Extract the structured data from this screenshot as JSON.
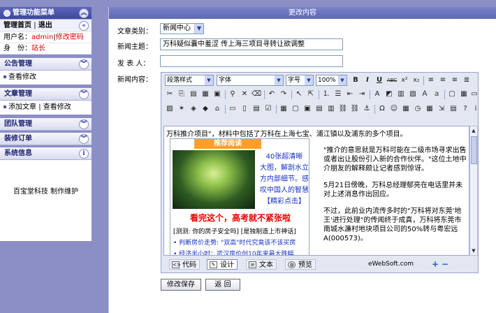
{
  "sidebar": {
    "menu_title": "管理功能菜单",
    "home_link": "管理首页",
    "nav_separator": "|",
    "logout_link": "退出",
    "user_label": "用户名：",
    "user_name": "admin",
    "pipe": "|",
    "change_pw": "修改密码",
    "role_label": "身　份：",
    "role_value": "站长",
    "sections": {
      "announce": {
        "title": "公告管理",
        "item": "查看修改"
      },
      "article": {
        "title": "文章管理",
        "item_add": "添加文章",
        "item_sep": "|",
        "item_view": "查看修改"
      },
      "team": {
        "title": "团队管理"
      },
      "orders": {
        "title": "装修订单"
      },
      "sysinfo": {
        "title": "系统信息"
      }
    },
    "footer_text": "百宝堂科技 制作维护"
  },
  "main": {
    "title": "更改内容",
    "fields": {
      "category_label": "文章类别：",
      "category_value": "新闻中心",
      "subject_label": "新闻主题：",
      "subject_value": "万科疑似囊中羞涩 传上海三项目寻转让欲调整",
      "publisher_label": "发 表 人：",
      "publisher_value": "",
      "content_label": "新闻内容："
    },
    "toolbar": {
      "para_style": "段落样式",
      "font": "字体",
      "font_size": "字号",
      "zoom": "100%",
      "bold": "B",
      "italic": "I",
      "underline": "U",
      "strike": "ABC",
      "sup": "x²",
      "sub": "x₂"
    },
    "content": {
      "intro": "万科推介项目\"，材料中包括了万科在上海七宝、浦江镇以及浦东的多个项目。",
      "ad_title": "推荐阅读",
      "ad_side": [
        "40张超清晰",
        "大图，解剖水立",
        "方内部细节。感",
        "叹中国人的智慧",
        "【精彩点击】"
      ],
      "ad_headline": "看完这个，高考就不紧张啦",
      "ad_lines": [
        "[测测: 你的房子安全吗] [是独制造上市神话]",
        "• 判断房价走势: \"双高\"时代究竟该不该买房",
        "• 经济半小时：武汉房价创10年来最大跌幅"
      ],
      "paragraphs": [
        "\"推介的意思就是万科可能在二级市场寻求出售或者出让股份引入新的合作伙伴。\"这位土地中介朋友的解释颇让记者感到惊讶。",
        "5月21日傍晚，万科总经理郁亮在电话里并未对上述消息作出回应。",
        "不过，此前业内流传多时的\"万科将对东莞'地王'进行处理\"的传闻终于成真，万科将东莞市南城水濂村地块项目公司的50%转与粤宏远A(000573)。"
      ]
    },
    "modes": [
      "代码",
      "设计",
      "文本",
      "预览"
    ],
    "brand": "eWebSoft.com",
    "buttons": {
      "save": "修改保存",
      "back": "返 回"
    }
  }
}
